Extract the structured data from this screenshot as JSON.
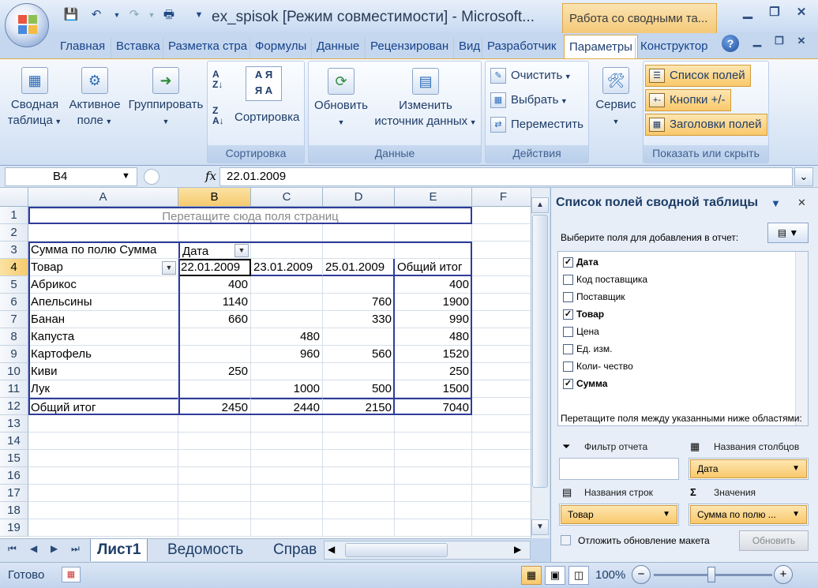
{
  "app": {
    "title": "ex_spisok  [Режим совместимости] - Microsoft...",
    "context_tab": "Работа со сводными та..."
  },
  "tabs": [
    "Главная",
    "Вставка",
    "Разметка стра",
    "Формулы",
    "Данные",
    "Рецензирован",
    "Вид",
    "Разработчик",
    "Параметры",
    "Конструктор"
  ],
  "ribbon": {
    "pivot_table": "Сводная\nтаблица",
    "active_field": "Активное\nполе",
    "group": "Группировать",
    "sort_label": "Сортировка",
    "sort_group": "Сортировка",
    "refresh": "Обновить",
    "change_source": "Изменить\nисточник данных",
    "data_group": "Данные",
    "clear": "Очистить",
    "select": "Выбрать",
    "move": "Переместить",
    "actions_group": "Действия",
    "service": "Сервис",
    "field_list": "Список полей",
    "buttons": "Кнопки +/-",
    "field_headers": "Заголовки полей",
    "show_group": "Показать или скрыть"
  },
  "formula_bar": {
    "name_box": "B4",
    "fx": "fx",
    "value": "22.01.2009"
  },
  "grid": {
    "columns": [
      "A",
      "B",
      "C",
      "D",
      "E",
      "F"
    ],
    "rows": [
      "1",
      "2",
      "3",
      "4",
      "5",
      "6",
      "7",
      "8",
      "9",
      "10",
      "11",
      "12",
      "13",
      "14",
      "15",
      "16",
      "17",
      "18",
      "19"
    ],
    "page_drop": "Перетащите сюда поля страниц",
    "sum_label": "Сумма по полю Сумма",
    "col_field": "Дата",
    "row_field": "Товар",
    "dates": [
      "22.01.2009",
      "23.01.2009",
      "25.01.2009",
      "Общий итог"
    ],
    "data": [
      {
        "item": "Абрикос",
        "v": [
          "400",
          "",
          "",
          "400"
        ]
      },
      {
        "item": "Апельсины",
        "v": [
          "1140",
          "",
          "760",
          "1900"
        ]
      },
      {
        "item": "Банан",
        "v": [
          "660",
          "",
          "330",
          "990"
        ]
      },
      {
        "item": "Капуста",
        "v": [
          "",
          "480",
          "",
          "480"
        ]
      },
      {
        "item": "Картофель",
        "v": [
          "",
          "960",
          "560",
          "1520"
        ]
      },
      {
        "item": "Киви",
        "v": [
          "250",
          "",
          "",
          "250"
        ]
      },
      {
        "item": "Лук",
        "v": [
          "",
          "1000",
          "500",
          "1500"
        ]
      }
    ],
    "total_label": "Общий итог",
    "totals": [
      "2450",
      "2440",
      "2150",
      "7040"
    ]
  },
  "sheets": [
    "Лист1",
    "Ведомость",
    "Справ"
  ],
  "status": {
    "ready": "Готово",
    "zoom": "100%"
  },
  "pane": {
    "title": "Список полей сводной таблицы",
    "choose": "Выберите поля для добавления в отчет:",
    "fields": [
      {
        "label": "Дата",
        "checked": true
      },
      {
        "label": "Код поставщика",
        "checked": false
      },
      {
        "label": "Поставщик",
        "checked": false
      },
      {
        "label": "Товар",
        "checked": true
      },
      {
        "label": "Цена",
        "checked": false
      },
      {
        "label": "Ед. изм.",
        "checked": false
      },
      {
        "label": "Коли- чество",
        "checked": false
      },
      {
        "label": "Сумма",
        "checked": true
      }
    ],
    "drag_hint": "Перетащите поля между указанными ниже областями:",
    "report_filter": "Фильтр отчета",
    "column_labels": "Названия столбцов",
    "row_labels": "Названия строк",
    "values": "Значения",
    "col_item": "Дата",
    "row_item": "Товар",
    "value_item": "Сумма по полю ...",
    "defer": "Отложить обновление макета",
    "update": "Обновить"
  }
}
